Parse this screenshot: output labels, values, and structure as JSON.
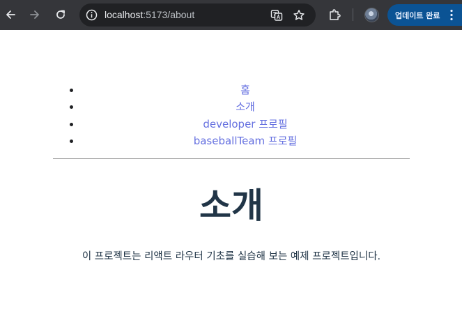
{
  "browser": {
    "url_host": "localhost",
    "url_path": ":5173/about",
    "update_button_label": "업데이트 완료",
    "icons": [
      "back-arrow-icon",
      "forward-arrow-icon",
      "reload-icon",
      "site-info-icon",
      "translate-icon",
      "bookmark-star-icon",
      "extensions-icon",
      "profile-avatar",
      "more-menu-icon"
    ],
    "colors": {
      "toolbar": "#35363a",
      "omnibox": "#202124",
      "update_button": "#0b5394"
    }
  },
  "nav": {
    "items": [
      {
        "label": "홈"
      },
      {
        "label": "소개"
      },
      {
        "label": "developer 프로필"
      },
      {
        "label": "baseballTeam 프로필"
      }
    ],
    "link_color": "#6570e0"
  },
  "main": {
    "title": "소개",
    "description": "이 프로젝트는 리액트 라우터 기초를 실습해 보는 예제 프로젝트입니다.",
    "text_color": "#213547"
  }
}
